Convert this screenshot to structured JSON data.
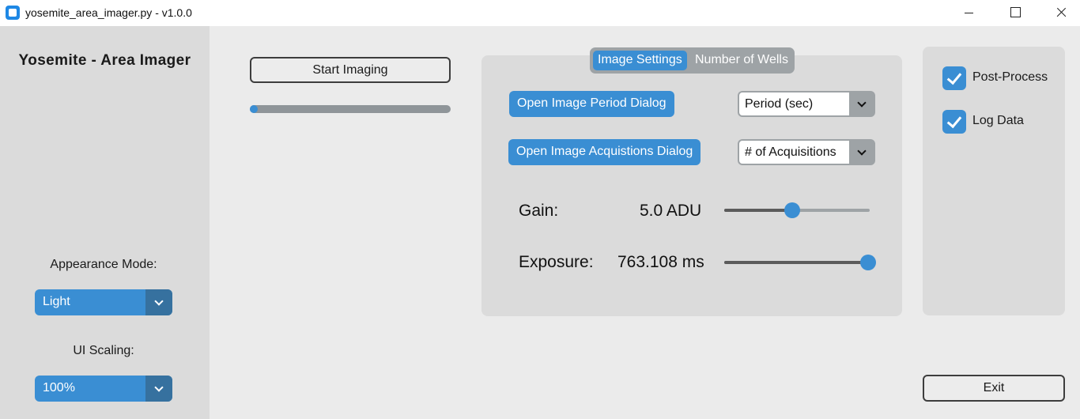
{
  "window": {
    "title": "yosemite_area_imager.py - v1.0.0"
  },
  "sidebar": {
    "app_title": "Yosemite - Area Imager",
    "appearance_label": "Appearance Mode:",
    "appearance_value": "Light",
    "scaling_label": "UI Scaling:",
    "scaling_value": "100%"
  },
  "imaging": {
    "start_button": "Start Imaging",
    "progress": 0.02
  },
  "tabs": {
    "items": [
      "Image Settings",
      "Number of Wells"
    ],
    "active": "Image Settings"
  },
  "image_settings": {
    "period_button": "Open Image Period Dialog",
    "period_combo": "Period (sec)",
    "acq_button": "Open Image Acquistions Dialog",
    "acq_combo": "# of Acquisitions",
    "gain_label": "Gain:",
    "gain_value": "5.0 ADU",
    "gain_slider": 0.47,
    "exposure_label": "Exposure:",
    "exposure_value": "763.108 ms",
    "exposure_slider": 1.0
  },
  "options": {
    "post_process": "Post-Process",
    "post_process_checked": true,
    "log_data": "Log Data",
    "log_data_checked": true
  },
  "exit_button": "Exit",
  "colors": {
    "accent": "#3a8ed3",
    "accent_dark": "#36719f",
    "panel": "#dbdbdb",
    "background": "#ebebeb"
  }
}
